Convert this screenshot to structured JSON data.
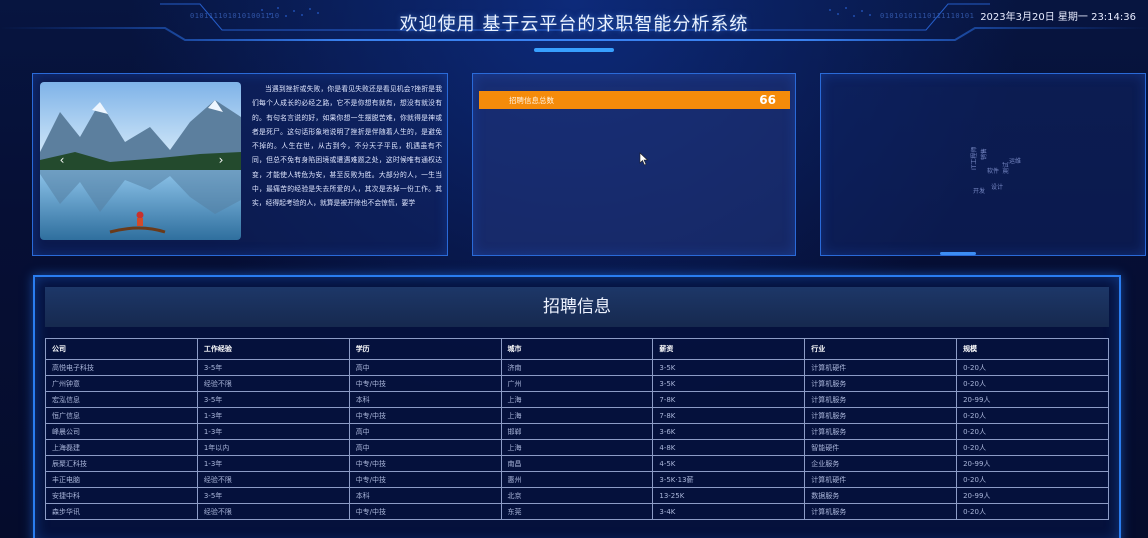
{
  "header": {
    "title": "欢迎使用 基于云平台的求职智能分析系统",
    "datetime": "2023年3月20日 星期一 23:14:36",
    "binary_left": "0101111010101001110",
    "binary_right": "01010101110111110101"
  },
  "intro": {
    "carousel_prev": "‹",
    "carousel_next": "›",
    "essay": "当遇到挫折或失败，你是看见失败还是看见机会?挫折是我们每个人成长的必经之路，它不是你想有就有，想没有就没有的。有句名言说的好，如果你想一生摆脱苦难，你就得是神或者是死尸。这句话形象地说明了挫折是伴随着人生的，是避免不掉的。人生在世，从古到今，不分天子平民，机遇虽有不同，但总不免有身陷困境或遭遇难题之处，这时候唯有通权达变，才能使人转危为安，甚至反败为胜。大部分的人，一生当中，最痛苦的经验是失去所爱的人，其次是丢掉一份工作。其实，经得起考验的人，就算是被开除也不会惊慌，要学"
  },
  "stats": {
    "label": "招聘信息总数",
    "value": "66"
  },
  "wordcloud": {
    "words": [
      "IT工程师",
      "销售",
      "软件",
      "测试",
      "运维",
      "开发",
      "设计"
    ]
  },
  "jobs": {
    "title": "招聘信息",
    "columns": [
      "公司",
      "工作经验",
      "学历",
      "城市",
      "薪资",
      "行业",
      "规模"
    ],
    "rows": [
      [
        "高悦电子科技",
        "3-5年",
        "高中",
        "济南",
        "3-5K",
        "计算机硬件",
        "0-20人"
      ],
      [
        "广州钟意",
        "经验不限",
        "中专/中技",
        "广州",
        "3-5K",
        "计算机服务",
        "0-20人"
      ],
      [
        "宏泓信息",
        "3-5年",
        "本科",
        "上海",
        "7-8K",
        "计算机服务",
        "20-99人"
      ],
      [
        "恒广信息",
        "1-3年",
        "中专/中技",
        "上海",
        "7-8K",
        "计算机服务",
        "0-20人"
      ],
      [
        "峰晨公司",
        "1-3年",
        "高中",
        "邯郸",
        "3-6K",
        "计算机服务",
        "0-20人"
      ],
      [
        "上海磊建",
        "1年以内",
        "高中",
        "上海",
        "4-8K",
        "智能硬件",
        "0-20人"
      ],
      [
        "辰聚汇科技",
        "1-3年",
        "中专/中技",
        "南昌",
        "4-5K",
        "企业服务",
        "20-99人"
      ],
      [
        "丰正电脑",
        "经验不限",
        "中专/中技",
        "惠州",
        "3-5K·13薪",
        "计算机硬件",
        "0-20人"
      ],
      [
        "安捷中科",
        "3-5年",
        "本科",
        "北京",
        "13-25K",
        "数据服务",
        "20-99人"
      ],
      [
        "森步华讯",
        "经验不限",
        "中专/中技",
        "东莞",
        "3-4K",
        "计算机服务",
        "0-20人"
      ]
    ]
  }
}
